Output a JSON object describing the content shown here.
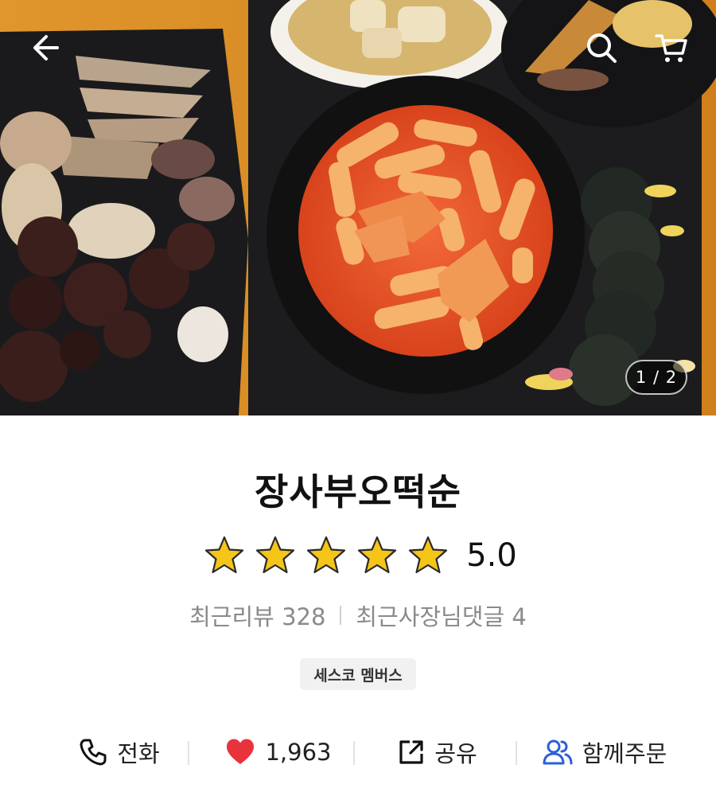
{
  "header": {
    "back_icon": "arrow-left-icon",
    "search_icon": "search-icon",
    "cart_icon": "cart-icon"
  },
  "gallery": {
    "counter": "1 / 2",
    "current": 1,
    "total": 2
  },
  "store": {
    "name": "장사부오떡순",
    "rating": "5.0",
    "rating_value": 5.0,
    "stars_filled": 5,
    "star_color": "#f5c518",
    "recent_reviews_label": "최근리뷰 328",
    "owner_comments_label": "최근사장님댓글 4",
    "badge": "세스코 멤버스"
  },
  "actions": {
    "call": {
      "label": "전화",
      "icon": "phone-icon"
    },
    "like": {
      "label": "1,963",
      "icon": "heart-icon",
      "color": "#e8323c"
    },
    "share": {
      "label": "공유",
      "icon": "share-icon"
    },
    "group_order": {
      "label": "함께주문",
      "icon": "people-icon",
      "color": "#2b5fd9"
    }
  }
}
